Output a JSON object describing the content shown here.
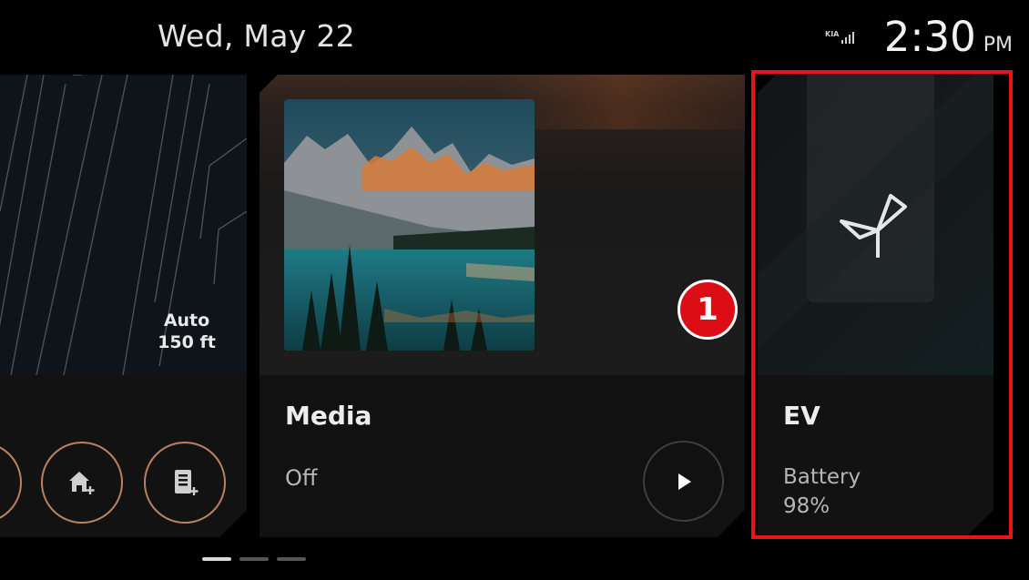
{
  "status_bar": {
    "date": "Wed, May 22",
    "time": "2:30",
    "ampm": "PM"
  },
  "nav_card": {
    "scale_mode": "Auto",
    "scale_distance": "150 ft",
    "buttons": [
      {
        "icon": "home-add-icon"
      },
      {
        "icon": "building-add-icon"
      }
    ]
  },
  "media_card": {
    "title": "Media",
    "status": "Off",
    "play_icon": "play-icon"
  },
  "ev_card": {
    "title": "EV",
    "battery_label": "Battery",
    "battery_value": "98%",
    "icon": "leaf-sprout-icon"
  },
  "annotation": {
    "badge_number": "1",
    "highlight_color": "#e8141c"
  },
  "pager": {
    "count": 3,
    "active_index": 0
  },
  "colors": {
    "accent_ring": "#b88262",
    "badge_red": "#dc0d14"
  }
}
